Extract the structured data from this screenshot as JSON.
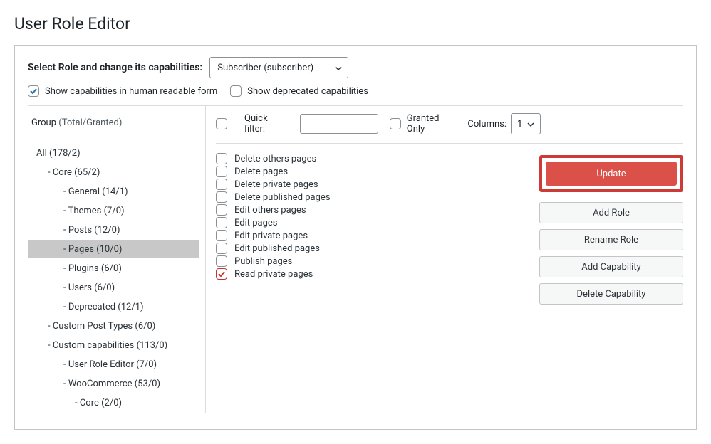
{
  "page_title": "User Role Editor",
  "top": {
    "label": "Select Role and change its capabilities:",
    "role_selected": "Subscriber (subscriber)"
  },
  "options": {
    "human_readable": {
      "label": "Show capabilities in human readable form",
      "checked": true
    },
    "deprecated": {
      "label": "Show deprecated capabilities",
      "checked": false
    }
  },
  "group": {
    "heading": "Group",
    "sub": "(Total/Granted)",
    "items": [
      {
        "label": "All (178/2)",
        "indent": 0,
        "selected": false
      },
      {
        "label": "Core (65/2)",
        "indent": 1,
        "selected": false
      },
      {
        "label": "General (14/1)",
        "indent": 2,
        "selected": false
      },
      {
        "label": "Themes (7/0)",
        "indent": 2,
        "selected": false
      },
      {
        "label": "Posts (12/0)",
        "indent": 2,
        "selected": false
      },
      {
        "label": "Pages (10/0)",
        "indent": 2,
        "selected": true
      },
      {
        "label": "Plugins (6/0)",
        "indent": 2,
        "selected": false
      },
      {
        "label": "Users (6/0)",
        "indent": 2,
        "selected": false
      },
      {
        "label": "Deprecated (12/1)",
        "indent": 2,
        "selected": false
      },
      {
        "label": "Custom Post Types (6/0)",
        "indent": 1,
        "selected": false
      },
      {
        "label": "Custom capabilities (113/0)",
        "indent": 1,
        "selected": false
      },
      {
        "label": "User Role Editor (7/0)",
        "indent": 2,
        "selected": false
      },
      {
        "label": "WooCommerce (53/0)",
        "indent": 2,
        "selected": false
      },
      {
        "label": "Core (2/0)",
        "indent": 3,
        "selected": false
      }
    ]
  },
  "filter": {
    "quick_filter_label": "Quick filter:",
    "granted_only_label": "Granted Only",
    "columns_label": "Columns:",
    "columns_value": "1"
  },
  "caps": [
    {
      "label": "Delete others pages",
      "checked": false
    },
    {
      "label": "Delete pages",
      "checked": false
    },
    {
      "label": "Delete private pages",
      "checked": false
    },
    {
      "label": "Delete published pages",
      "checked": false
    },
    {
      "label": "Edit others pages",
      "checked": false
    },
    {
      "label": "Edit pages",
      "checked": false
    },
    {
      "label": "Edit private pages",
      "checked": false
    },
    {
      "label": "Edit published pages",
      "checked": false
    },
    {
      "label": "Publish pages",
      "checked": false
    },
    {
      "label": "Read private pages",
      "checked": true
    }
  ],
  "actions": {
    "update": "Update",
    "add_role": "Add Role",
    "rename_role": "Rename Role",
    "add_capability": "Add Capability",
    "delete_capability": "Delete Capability"
  }
}
